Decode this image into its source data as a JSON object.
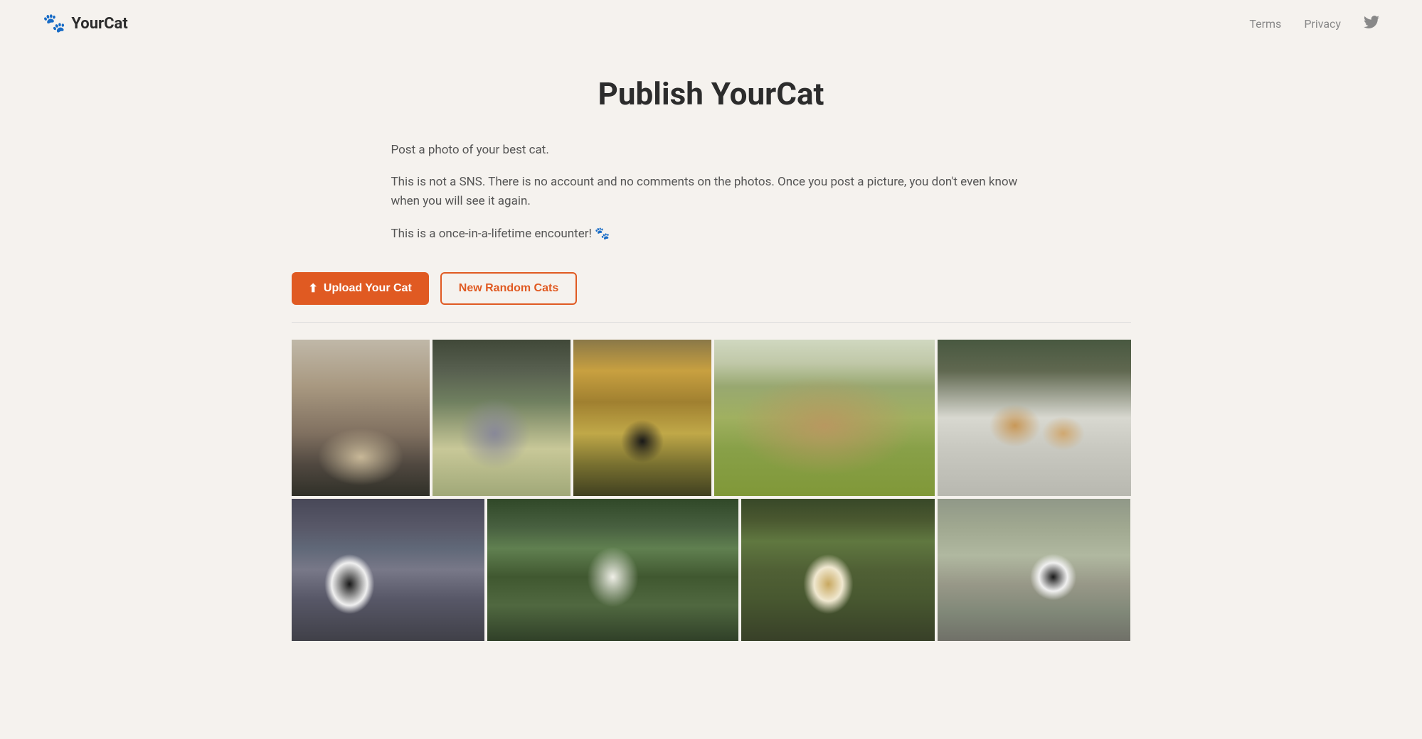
{
  "header": {
    "logo_icon": "🐾",
    "logo_text": "YourCat",
    "nav": {
      "terms_label": "Terms",
      "privacy_label": "Privacy",
      "twitter_icon": "twitter"
    }
  },
  "hero": {
    "title": "Publish YourCat",
    "description_1": "Post a photo of your best cat.",
    "description_2": "This is not a SNS. There is no account and no comments on the photos. Once you post a picture, you don't even know when you will see it again.",
    "description_3": "This is a once-in-a-lifetime encounter! 🐾"
  },
  "buttons": {
    "upload_label": "Upload Your Cat",
    "random_label": "New Random Cats",
    "upload_icon": "⬆"
  },
  "photos": {
    "row1": [
      {
        "id": "cat-chair",
        "alt": "Cat sitting in camping chair"
      },
      {
        "id": "cat-garden-walk",
        "alt": "Gray cat walking in garden"
      },
      {
        "id": "cat-black-leaves",
        "alt": "Black cat among autumn leaves"
      },
      {
        "id": "cat-tabby-grass",
        "alt": "Large tabby cat lying in grass"
      },
      {
        "id": "cat-two-cats",
        "alt": "Two cats on snowy surface"
      }
    ],
    "row2": [
      {
        "id": "cat-tuxedo-roof",
        "alt": "Tuxedo cat on rooftop"
      },
      {
        "id": "cat-white-green",
        "alt": "White cat in green garden"
      },
      {
        "id": "cat-striped-pole",
        "alt": "Cat near bushes and pole"
      },
      {
        "id": "cat-stone-wall",
        "alt": "Black and white cat on stone wall"
      }
    ]
  }
}
